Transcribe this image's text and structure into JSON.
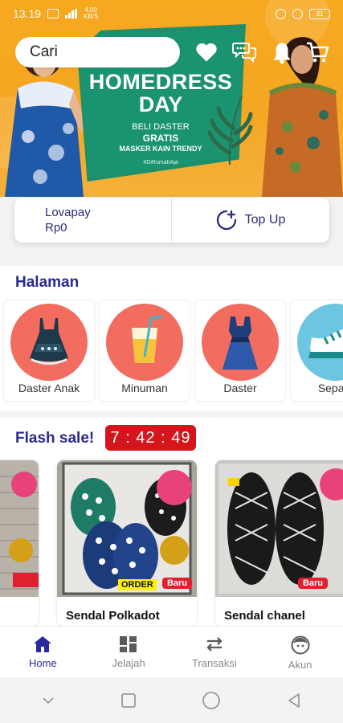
{
  "status_bar": {
    "time": "13.19",
    "network_rate": "4.00\nKB/S",
    "battery": "31"
  },
  "search": {
    "placeholder": "Cari"
  },
  "banner": {
    "title_line1": "HOMEDRESS",
    "title_line2": "DAY",
    "subtitle_line1": "BELI DASTER",
    "subtitle_line2": "GRATIS",
    "subtitle_line3": "MASKER KAIN TRENDY",
    "hashtag": "#DiRumahAja"
  },
  "wallet": {
    "name": "Lovapay",
    "balance": "Rp0",
    "topup_label": "Top Up"
  },
  "halaman": {
    "title": "Halaman",
    "categories": [
      {
        "label": "Daster Anak",
        "icon": "kids-dress-icon",
        "color": "#f26c5f"
      },
      {
        "label": "Minuman",
        "icon": "drink-icon",
        "color": "#f26c5f"
      },
      {
        "label": "Daster",
        "icon": "dress-icon",
        "color": "#f26c5f"
      },
      {
        "label": "Sepatu",
        "icon": "shoe-icon",
        "color": "#6cc6e2"
      }
    ]
  },
  "flash_sale": {
    "title": "Flash sale!",
    "timer": "7 : 42 : 49",
    "products": [
      {
        "name": "Sendal Polkadot",
        "badge": "Baru",
        "order_badge": "ORDER"
      },
      {
        "name": "Sendal chanel",
        "badge": "Baru"
      }
    ]
  },
  "bottom_nav": {
    "items": [
      {
        "label": "Home",
        "icon": "home-icon",
        "active": true
      },
      {
        "label": "Jelajah",
        "icon": "explore-grid-icon",
        "active": false
      },
      {
        "label": "Transaksi",
        "icon": "transaction-arrows-icon",
        "active": false
      },
      {
        "label": "Akun",
        "icon": "account-face-icon",
        "active": false
      }
    ]
  },
  "colors": {
    "primary": "#2a2aa0",
    "banner": "#f5a623",
    "banner_panel": "#1a9470",
    "timer": "#d5151c",
    "category_circle": "#f26c5f"
  }
}
